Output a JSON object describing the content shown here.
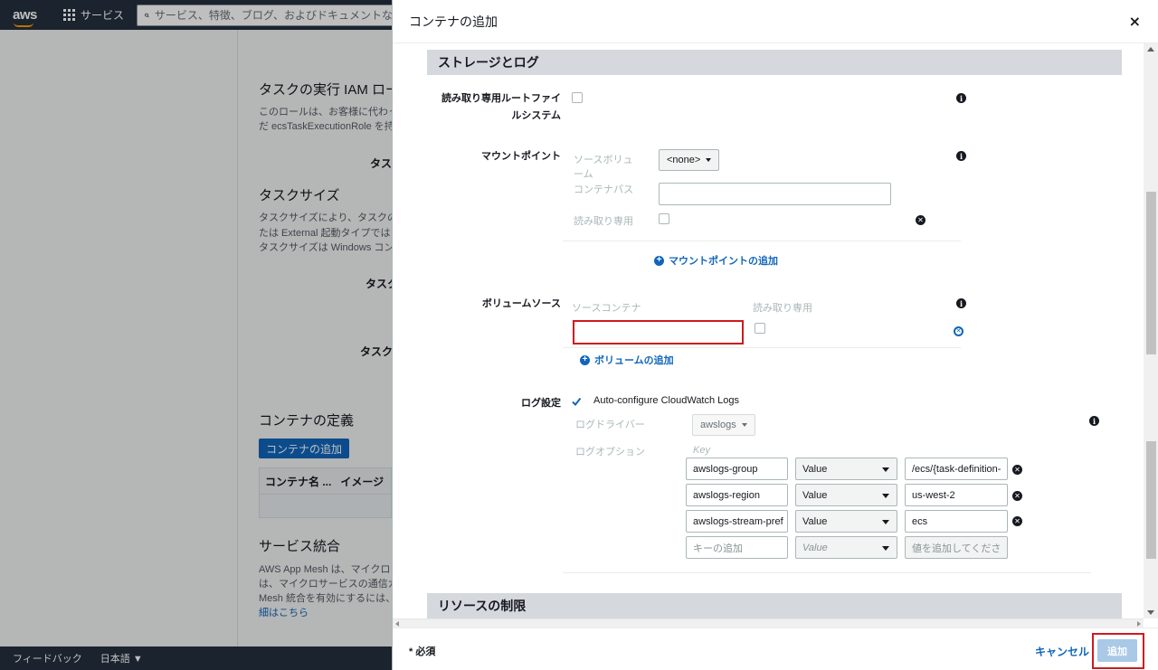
{
  "topnav": {
    "logo": "aws",
    "services_label": "サービス",
    "search_placeholder": "サービス、特徴、ブログ、およびドキュメントなどを検"
  },
  "background": {
    "role_heading": "タスクの実行 IAM ロー",
    "role_desc_1": "このロールは、お客様に代わっ",
    "role_desc_2": "だ ecsTaskExecutionRole を持",
    "field_task_1": "タス",
    "size_heading": "タスクサイズ",
    "size_desc_1": "タスクサイズにより、タスクの",
    "size_desc_2": "たは External 起動タイプでは",
    "size_desc_3": "タスクサイズは Windows コン",
    "field_task_2": "タスク",
    "field_task_3": "タスク",
    "container_def_heading": "コンテナの定義",
    "add_container_button": "コンテナの追加",
    "table_col_name": "コンテナ名 ...",
    "table_col_image": "イメージ",
    "service_integration_heading": "サービス統合",
    "si_desc_1": "AWS App Mesh は、マイクロ",
    "si_desc_2": "は、マイクロサービスの通信ガ",
    "si_desc_3": "Mesh 統合を有効にするには、",
    "si_link": "細はこちら"
  },
  "footer": {
    "feedback": "フィードバック",
    "language": "日本語 ▼"
  },
  "modal": {
    "title": "コンテナの追加",
    "close": "×",
    "storage_section_title": "ストレージとログ",
    "readonly_root_label_1": "読み取り専用ルートファイ",
    "readonly_root_label_2": "ルシステム",
    "mount_points_label": "マウントポイント",
    "source_volume_label_1": "ソースボリュ",
    "source_volume_label_2": "ーム",
    "source_volume_value": "<none>",
    "container_path_label": "コンテナパス",
    "mount_readonly_label": "読み取り専用",
    "add_mount_point": "マウントポイントの追加",
    "volumes_from_label": "ボリュームソース",
    "source_container_label": "ソースコンテナ",
    "volumes_readonly_label": "読み取り専用",
    "add_volume": "ボリュームの追加",
    "log_config_label": "ログ設定",
    "auto_configure_label": "Auto-configure CloudWatch Logs",
    "log_driver_label": "ログドライバー",
    "log_driver_value": "awslogs",
    "log_options_label": "ログオプション",
    "key_header": "Key",
    "log_options": [
      {
        "key": "awslogs-group",
        "type": "Value",
        "value": "/ecs/{task-definition-"
      },
      {
        "key": "awslogs-region",
        "type": "Value",
        "value": "us-west-2"
      },
      {
        "key": "awslogs-stream-pref",
        "type": "Value",
        "value": "ecs"
      }
    ],
    "new_option": {
      "key_placeholder": "キーの追加",
      "type": "Value",
      "value_placeholder": "値を追加してくださ"
    },
    "resource_section_title": "リソースの制限",
    "required_note": "* 必須",
    "cancel_label": "キャンセル",
    "add_label": "追加"
  },
  "colors": {
    "nav_bg": "#232f3e",
    "link_blue": "#1166bb",
    "highlight_red": "#d0191e"
  }
}
